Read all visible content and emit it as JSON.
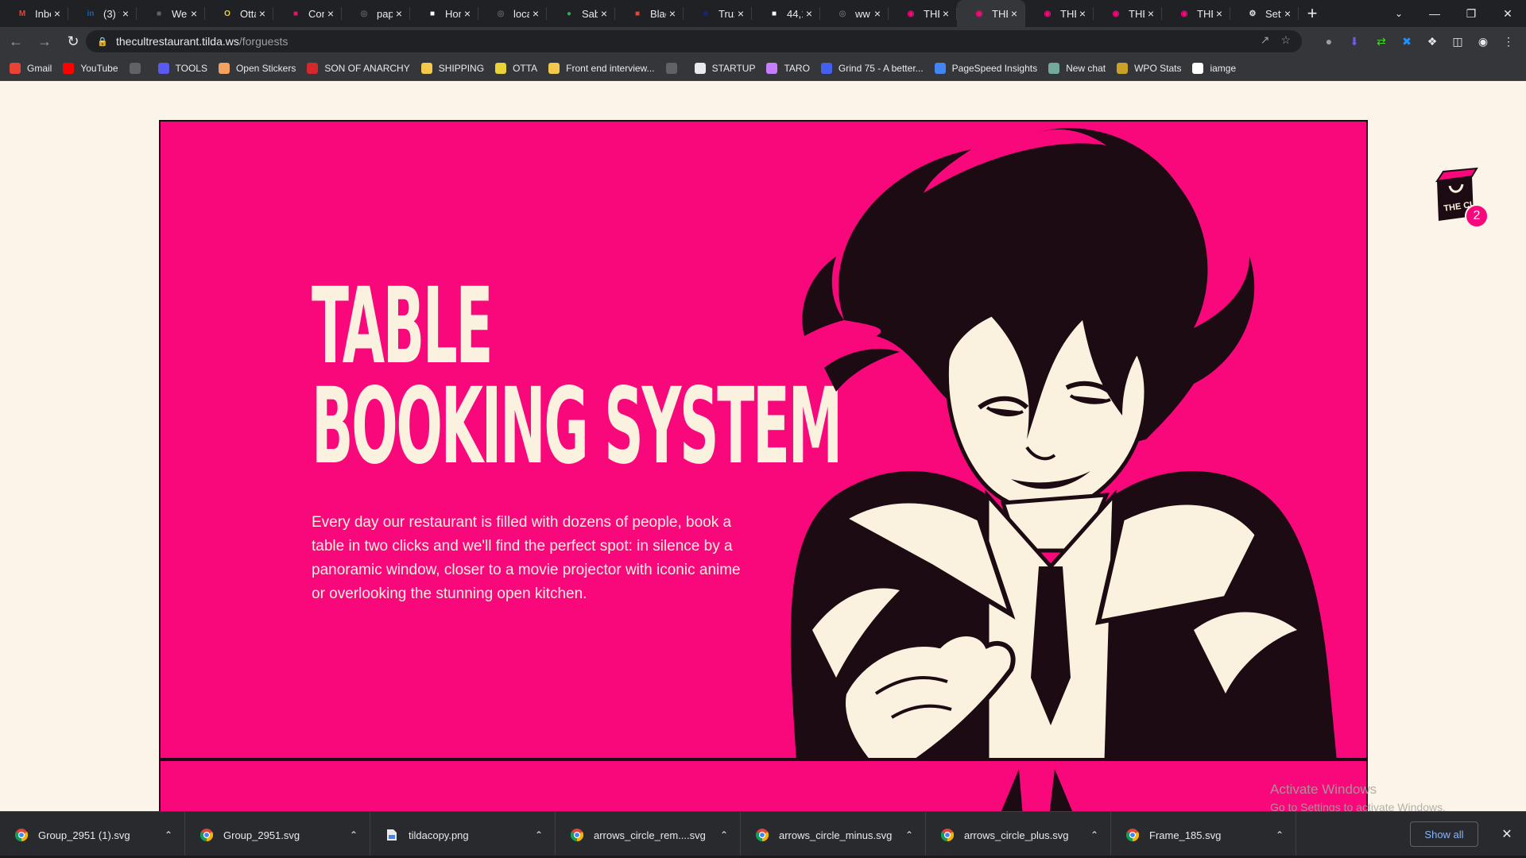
{
  "browser": {
    "tabs": [
      {
        "label": "Inbo",
        "icon": "gmail-icon",
        "color": "#ea4335"
      },
      {
        "label": "(3) f",
        "icon": "linkedin-icon",
        "color": "#0a66c2"
      },
      {
        "label": "We",
        "icon": "site-icon",
        "color": "#5f6368"
      },
      {
        "label": "Otta",
        "icon": "otta-icon",
        "color": "#e9d336"
      },
      {
        "label": "Con",
        "icon": "site-icon",
        "color": "#e8116c"
      },
      {
        "label": "pap",
        "icon": "globe-icon",
        "color": "#5f6368"
      },
      {
        "label": "Hon",
        "icon": "site-icon",
        "color": "#ffffff"
      },
      {
        "label": "loca",
        "icon": "globe-icon",
        "color": "#5f6368"
      },
      {
        "label": "Sab",
        "icon": "map-pin-icon",
        "color": "#34a853"
      },
      {
        "label": "Blac",
        "icon": "site-icon",
        "color": "#ea4335"
      },
      {
        "label": "Truz",
        "icon": "site-icon",
        "color": "#1a237e"
      },
      {
        "label": "44,1",
        "icon": "site-icon",
        "color": "#ffffff"
      },
      {
        "label": "ww",
        "icon": "globe-icon",
        "color": "#5f6368"
      },
      {
        "label": "THE",
        "icon": "cult-icon",
        "color": "#f9087c"
      },
      {
        "label": "THE",
        "icon": "cult-icon",
        "color": "#f9087c"
      },
      {
        "label": "THE",
        "icon": "cult-icon",
        "color": "#f9087c"
      },
      {
        "label": "THE",
        "icon": "cult-icon",
        "color": "#f9087c"
      },
      {
        "label": "THE",
        "icon": "cult-icon",
        "color": "#f9087c"
      },
      {
        "label": "Setti",
        "icon": "gear-icon",
        "color": "#e8eaed"
      }
    ],
    "active_tab_index": 14,
    "url_host": "thecultrestaurant.tilda.ws",
    "url_path": "/forguests",
    "bookmarks": [
      {
        "label": "Gmail",
        "icon": "gmail-icon",
        "color": "#ea4335"
      },
      {
        "label": "YouTube",
        "icon": "youtube-icon",
        "color": "#ff0000"
      },
      {
        "label": "",
        "icon": "globe-icon",
        "color": "#5f6368"
      },
      {
        "label": "TOOLS",
        "icon": "tools-icon",
        "color": "#5a5af0"
      },
      {
        "label": "Open Stickers",
        "icon": "sticker-icon",
        "color": "#f4a261"
      },
      {
        "label": "SON OF ANARCHY",
        "icon": "flag-icon",
        "color": "#d62828"
      },
      {
        "label": "SHIPPING",
        "icon": "chevrons-icon",
        "color": "#f2c94c"
      },
      {
        "label": "OTTA",
        "icon": "otta-icon",
        "color": "#e9d336"
      },
      {
        "label": "Front end interview...",
        "icon": "folder-icon",
        "color": "#f2c94c"
      },
      {
        "label": "",
        "icon": "globe-icon",
        "color": "#5f6368"
      },
      {
        "label": "STARTUP",
        "icon": "list-icon",
        "color": "#e8eaed"
      },
      {
        "label": "TARO",
        "icon": "gift-icon",
        "color": "#c77dff"
      },
      {
        "label": "Grind 75 - A better...",
        "icon": "grind-icon",
        "color": "#4361ee"
      },
      {
        "label": "PageSpeed Insights",
        "icon": "pagespeed-icon",
        "color": "#4285f4"
      },
      {
        "label": "New chat",
        "icon": "chat-icon",
        "color": "#74aa9c"
      },
      {
        "label": "WPO Stats",
        "icon": "image-icon",
        "color": "#c9a227"
      },
      {
        "label": "iamge",
        "icon": "is-icon",
        "color": "#ffffff"
      }
    ]
  },
  "page": {
    "hero_title_line1": "TABLE",
    "hero_title_line2": "BOOKING SYSTEM",
    "hero_text": "Every day our restaurant is filled with dozens of people, book a table in two clicks and we'll find the perfect spot: in silence by a panoramic window, closer to a movie projector with iconic anime or overlooking the stunning open kitchen.",
    "cart_count": "2",
    "accent_color": "#f9087c",
    "cream_color": "#fbf1df",
    "ink_color": "#1c0b12"
  },
  "system": {
    "watermark_title": "Activate Windows",
    "watermark_sub": "Go to Settings to activate Windows."
  },
  "downloads": {
    "items": [
      {
        "name": "Group_2951 (1).svg",
        "icon": "chrome-file-icon"
      },
      {
        "name": "Group_2951.svg",
        "icon": "chrome-file-icon"
      },
      {
        "name": "tildacopy.png",
        "icon": "image-file-icon"
      },
      {
        "name": "arrows_circle_rem....svg",
        "icon": "chrome-file-icon"
      },
      {
        "name": "arrows_circle_minus.svg",
        "icon": "chrome-file-icon"
      },
      {
        "name": "arrows_circle_plus.svg",
        "icon": "chrome-file-icon"
      },
      {
        "name": "Frame_185.svg",
        "icon": "chrome-file-icon"
      }
    ],
    "show_all_label": "Show all"
  }
}
